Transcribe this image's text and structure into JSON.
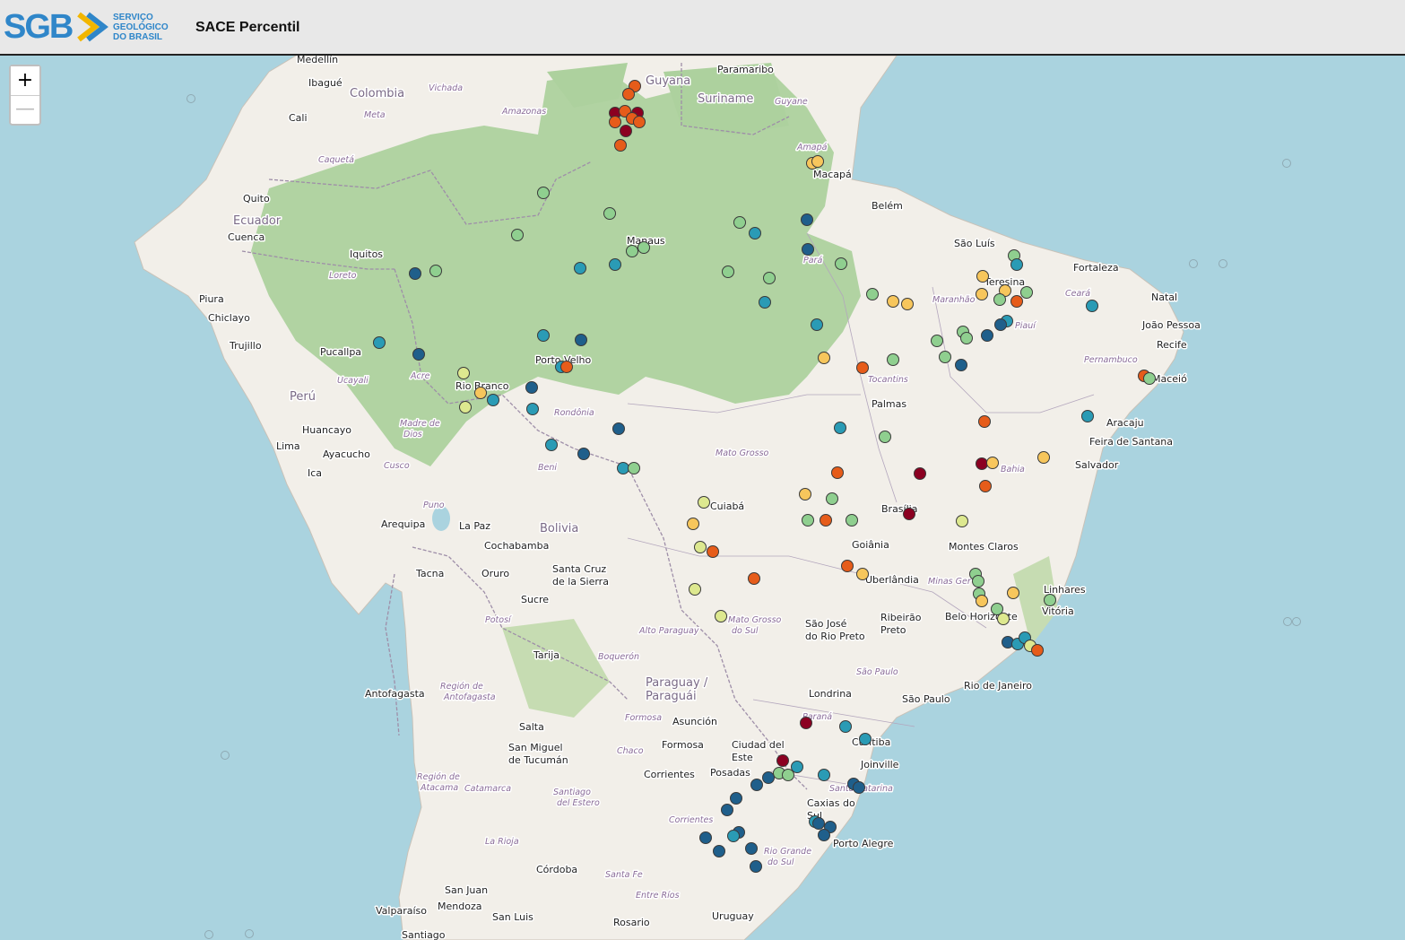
{
  "header": {
    "logo_letters": "SGB",
    "logo_lines": [
      "SERVIÇO",
      "GEOLÓGICO",
      "DO BRASIL"
    ],
    "title": "SACE Percentil"
  },
  "zoom": {
    "in_label": "+",
    "out_label": "—"
  },
  "colors": {
    "ocean": "#aad3df",
    "land": "#f2efe9",
    "forest": "#add19e",
    "border": "#9e8ea8",
    "header_bg": "#e8e8e8",
    "logo_blue": "#2f86c9",
    "logo_accent": "#f2b600"
  },
  "percentile_colors": [
    "#8b0021",
    "#e65c1a",
    "#f7c65c",
    "#dde88f",
    "#8fcf8f",
    "#2a9bb5",
    "#1f5f8b"
  ],
  "country_labels": [
    "Colombia",
    "Ecuador",
    "Perú",
    "Bolivia",
    "Paraguay / Paraguái",
    "Guyana",
    "Suriname"
  ],
  "city_labels": [
    "Medellín",
    "Ibagué",
    "Cali",
    "Quito",
    "Cuenca",
    "Piura",
    "Chiclayo",
    "Trujillo",
    "Iquitos",
    "Pucallpa",
    "Huancayo",
    "Lima",
    "Ayacucho",
    "Ica",
    "Arequipa",
    "Tacna",
    "La Paz",
    "Cochabamba",
    "Oruro",
    "Sucre",
    "Santa Cruz de la Sierra",
    "Tarija",
    "Antofagasta",
    "Salta",
    "San Miguel de Tucumán",
    "Córdoba",
    "San Juan",
    "Mendoza",
    "San Luis",
    "Valparaíso",
    "Santiago",
    "Rosario",
    "Asunción",
    "Formosa",
    "Corrientes",
    "Posadas",
    "Ciudad del Este",
    "Paramaribo",
    "Macapá",
    "Belém",
    "São Luís",
    "Fortaleza",
    "Natal",
    "João Pessoa",
    "Recife",
    "Maceió",
    "Aracaju",
    "Teresina",
    "Palmas",
    "Feira de Santana",
    "Salvador",
    "Manaus",
    "Porto Velho",
    "Rio Branco",
    "Cuiabá",
    "Brasília",
    "Goiânia",
    "Uberlândia",
    "Montes Claros",
    "Belo Horizonte",
    "Vitória",
    "Linhares",
    "Ribeirão Preto",
    "São José do Rio Preto",
    "Rio de Janeiro",
    "São Paulo",
    "Londrina",
    "Curitiba",
    "Joinville",
    "Caxias do Sul",
    "Porto Alegre",
    "Uruguay"
  ],
  "region_labels": [
    "Vichada",
    "Meta",
    "Amazonas",
    "Caquetá",
    "Loreto",
    "Ucayali",
    "Acre",
    "Madre de Dios",
    "Cusco",
    "Puno",
    "Beni",
    "Rondônia",
    "Mato Grosso",
    "Mato Grosso do Sul",
    "Pará",
    "Amapá",
    "Maranhão",
    "Piauí",
    "Ceará",
    "Pernambuco",
    "Tocantins",
    "Bahia",
    "Minas Gerais",
    "São Paulo",
    "Paraná",
    "Santa Catarina",
    "Rio Grande do Sul",
    "Alto Paraguay",
    "Boquerón",
    "Chaco",
    "Formosa",
    "Santiago del Estero",
    "Catamarca",
    "Región de Antofagasta",
    "Región de Atacama",
    "Potosí",
    "La Rioja",
    "Santa Fe",
    "Entre Ríos",
    "Corrientes",
    "Guyane",
    "Región de Atacama"
  ]
}
